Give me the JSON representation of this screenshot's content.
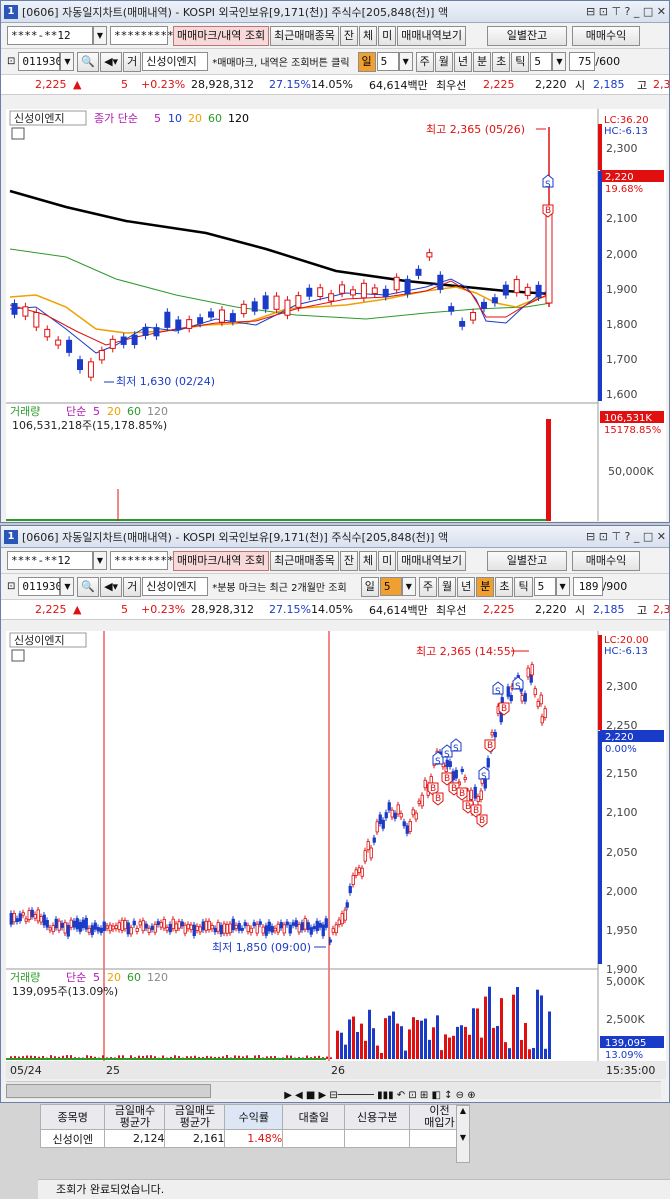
{
  "windows": [
    {
      "title": "[0606] 자동일지차트(매매내역) - KOSPI 외국인보유[9,171(천)] 주식수[205,848(천)] 액",
      "account": "****-**12",
      "password": "*********",
      "btn_mark": "매매마크/내역 조회",
      "btn_recent": "최근매매종목",
      "btn_jan": "잔",
      "btn_che": "체",
      "btn_mi": "미",
      "btn_history": "매매내역보기",
      "btn_daily": "일별잔고",
      "btn_profit": "매매수익",
      "code": "011930",
      "geo": "거",
      "stock_name": "신성이엔지",
      "notice": "*매매마크, 내역은 조회버튼 클릭",
      "period_il": "일",
      "period_val": "5",
      "btn_ju": "주",
      "btn_wol": "월",
      "btn_nyeon": "년",
      "btn_bun": "분",
      "btn_cho": "초",
      "btn_tik": "틱",
      "tik_val": "5",
      "count": "75",
      "count_total": "/600",
      "quote": {
        "price": "2,225",
        "arrow": "▲",
        "change": "5",
        "rate": "+0.23%",
        "volume": "28,928,312",
        "rate2": "27.15%",
        "rate3": "14.05%",
        "amount": "64,614백만",
        "best_label": "최우선",
        "bid": "2,225",
        "ask": "2,220",
        "open_label": "시",
        "open": "2,185",
        "high_label": "고",
        "high": "2,3"
      },
      "price_panel": {
        "legend_name": "신성이엔지",
        "legend_ma": "종가 단순",
        "ma5": "5",
        "ma10": "10",
        "ma20": "20",
        "ma60": "60",
        "ma120": "120",
        "high_label": "최고 2,365 (05/26)",
        "low_label": "최저 1,630 (02/24)",
        "lc": "LC:36.20",
        "hc": "HC:-6.13",
        "cur_price": "2,220",
        "cur_rate": "19.68%",
        "ticks": [
          "2,300",
          "2,200",
          "2,100",
          "2,000",
          "1,900",
          "1,800",
          "1,700",
          "1,600"
        ]
      },
      "vol_panel": {
        "legend": "거래량",
        "ma_label": "단순",
        "ma5": "5",
        "ma20": "20",
        "ma60": "60",
        "ma120": "120",
        "sub": "106,531,218주(15,178.85%)",
        "cur": "106,531K",
        "cur_rate": "15178.85%",
        "tick": "50,000K"
      }
    },
    {
      "title": "[0606] 자동일지차트(매매내역) - KOSPI 외국인보유[9,171(천)] 주식수[205,848(천)] 액",
      "account": "****-**12",
      "password": "*********",
      "btn_mark": "매매마크/내역 조회",
      "btn_recent": "최근매매종목",
      "btn_jan": "잔",
      "btn_che": "체",
      "btn_mi": "미",
      "btn_history": "매매내역보기",
      "btn_daily": "일별잔고",
      "btn_profit": "매매수익",
      "code": "011930",
      "geo": "거",
      "stock_name": "신성이엔지",
      "notice": "*분봉 마크는 최근 2개월만 조회",
      "period_il": "일",
      "period_val": "5",
      "btn_ju": "주",
      "btn_wol": "월",
      "btn_nyeon": "년",
      "btn_bun": "분",
      "btn_cho": "초",
      "btn_tik": "틱",
      "tik_val": "5",
      "count": "189",
      "count_total": "/900",
      "quote": {
        "price": "2,225",
        "arrow": "▲",
        "change": "5",
        "rate": "+0.23%",
        "volume": "28,928,312",
        "rate2": "27.15%",
        "rate3": "14.05%",
        "amount": "64,614백만",
        "best_label": "최우선",
        "bid": "2,225",
        "ask": "2,220",
        "open_label": "시",
        "open": "2,185",
        "high_label": "고",
        "high": "2,3"
      },
      "price_panel": {
        "legend_name": "신성이엔지",
        "high_label": "최고 2,365 (14:55)",
        "low_label": "최저 1,850 (09:00)",
        "lc": "LC:20.00",
        "hc": "HC:-6.13",
        "cur_price": "2,220",
        "cur_rate": "0.00%",
        "ticks": [
          "2,350",
          "2,300",
          "2,250",
          "2,200",
          "2,150",
          "2,100",
          "2,050",
          "2,000",
          "1,950",
          "1,900",
          "1,850"
        ]
      },
      "vol_panel": {
        "legend": "거래량",
        "ma_label": "단순",
        "ma5": "5",
        "ma20": "20",
        "ma60": "60",
        "ma120": "120",
        "sub": "139,095주(13.09%)",
        "cur": "139,095",
        "cur_rate": "13.09%",
        "ticks": [
          "5,000K",
          "2,500K"
        ]
      },
      "xaxis": [
        "05/24",
        "25",
        "26",
        "15:35:00"
      ]
    }
  ],
  "bottom_table": {
    "headers": [
      "종목명",
      "금일매수\n평균가",
      "금일매도\n평균가",
      "수익률",
      "대출일",
      "신용구분",
      "이전\n매입가"
    ],
    "row": [
      "신성이엔",
      "2,124",
      "2,161",
      "1.48%",
      "",
      "",
      ""
    ]
  },
  "status": "조회가 완료되었습니다.",
  "colors": {
    "up": "#e01010",
    "down": "#1a3ac8",
    "ma5": "#1a3ac8",
    "ma10": "#e01010",
    "ma20": "#f0a000",
    "ma60": "#2a9a2a",
    "ma120": "#000000"
  }
}
